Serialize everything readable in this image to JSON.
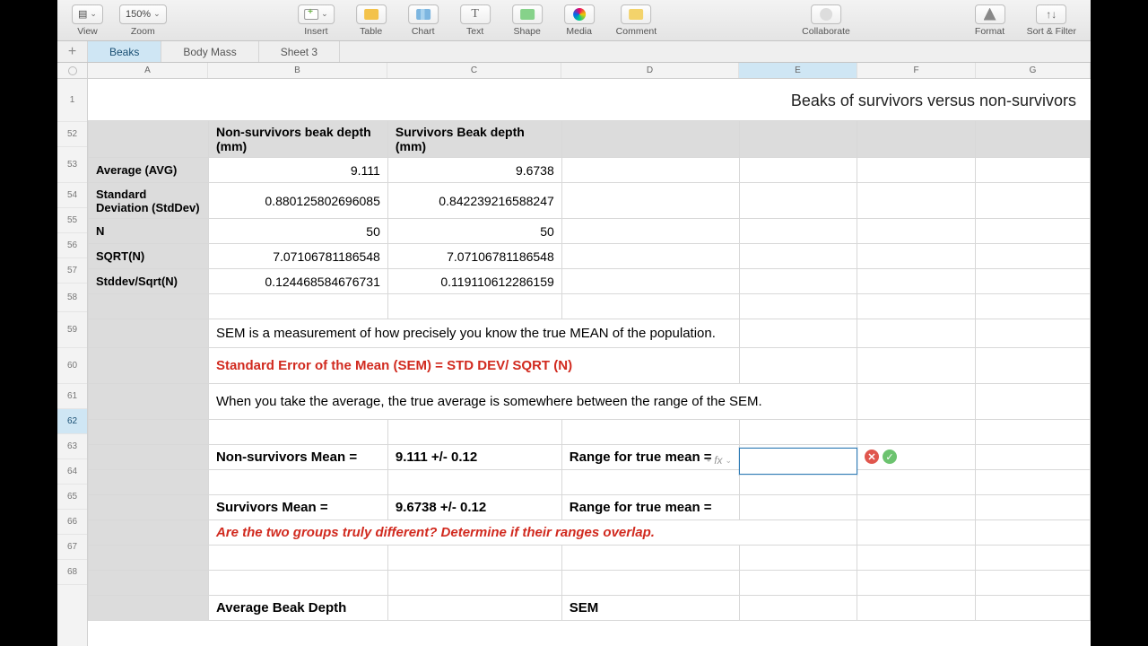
{
  "toolbar": {
    "view": "View",
    "zoom_value": "150%",
    "zoom": "Zoom",
    "insert": "Insert",
    "table": "Table",
    "chart": "Chart",
    "text": "Text",
    "shape": "Shape",
    "media": "Media",
    "comment": "Comment",
    "collaborate": "Collaborate",
    "format": "Format",
    "sort_filter": "Sort & Filter"
  },
  "tabs": [
    "Beaks",
    "Body Mass",
    "Sheet 3"
  ],
  "columns": [
    "A",
    "B",
    "C",
    "D",
    "E",
    "F",
    "G"
  ],
  "active_column": "E",
  "title": "Beaks of survivors versus non-survivors",
  "row_numbers": [
    "1",
    "52",
    "53",
    "54",
    "55",
    "56",
    "57",
    "58",
    "59",
    "60",
    "61",
    "62",
    "63",
    "64",
    "65",
    "66",
    "67",
    "68"
  ],
  "active_row": "62",
  "header_row": {
    "b": "Non-survivors beak depth (mm)",
    "c": "Survivors Beak depth (mm)"
  },
  "rows": {
    "avg": {
      "label": "Average (AVG)",
      "b": "9.111",
      "c": "9.6738"
    },
    "sd": {
      "label": "Standard Deviation (StdDev)",
      "b": "0.880125802696085",
      "c": "0.842239216588247"
    },
    "n": {
      "label": "N",
      "b": "50",
      "c": "50"
    },
    "sqrtn": {
      "label": "SQRT(N)",
      "b": "7.07106781186548",
      "c": "7.07106781186548"
    },
    "sdsn": {
      "label": "Stddev/Sqrt(N)",
      "b": "0.124468584676731",
      "c": "0.119110612286159"
    }
  },
  "text_rows": {
    "sem_desc": "SEM is a measurement of how precisely you know the true MEAN of the population.",
    "sem_formula": "Standard Error of the Mean (SEM) = STD DEV/ SQRT (N)",
    "avg_desc": "When you take the average, the true average is somewhere between the range of the SEM."
  },
  "mean_rows": {
    "ns": {
      "label": "Non-survivors Mean =",
      "val": "9.111 +/- 0.12",
      "range": "Range for true mean ="
    },
    "sv": {
      "label": "Survivors Mean =",
      "val": "9.6738 +/- 0.12",
      "range": "Range for true mean ="
    }
  },
  "question": "Are the two groups truly different?  Determine if their ranges overlap.",
  "bottom": {
    "b": "Average Beak Depth",
    "d": "SEM"
  },
  "fx": {
    "hint": "fx"
  }
}
